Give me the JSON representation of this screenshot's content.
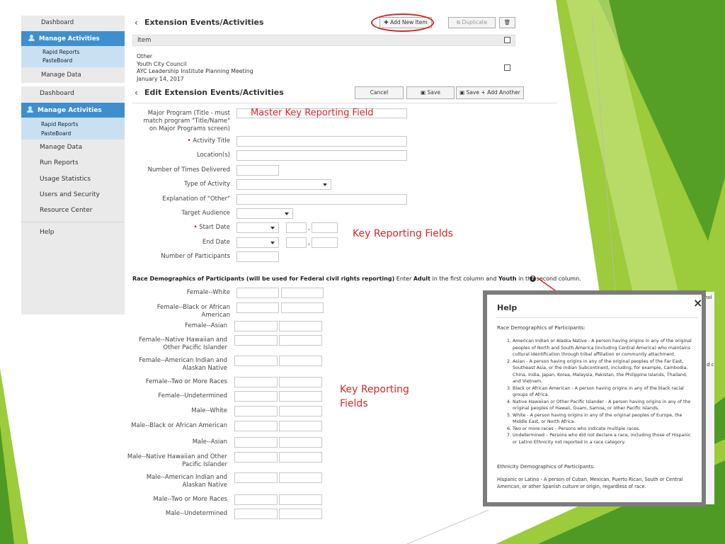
{
  "sidebar_top": {
    "dashboard": "Dashboard",
    "manage_activities": "Manage Activities",
    "rapid_reports": "Rapid Reports",
    "pasteboard": "PasteBoard",
    "manage_data": "Manage Data"
  },
  "sidebar": {
    "dashboard": "Dashboard",
    "manage_activities": "Manage Activities",
    "rapid_reports": "Rapid Reports",
    "pasteboard": "PasteBoard",
    "manage_data": "Manage Data",
    "run_reports": "Run Reports",
    "usage_statistics": "Usage Statistics",
    "users_security": "Users and Security",
    "resource_center": "Resource Center",
    "help": "Help"
  },
  "list": {
    "title": "Extension Events/Activities",
    "add_new": "Add New Item",
    "duplicate": "Duplicate",
    "col_item": "Item",
    "row_lines": [
      "Other",
      "Youth City Council",
      "AYC Leadership Institute Planning Meeting",
      "January 14, 2017"
    ]
  },
  "edit": {
    "title": "Edit Extension Events/Activities",
    "cancel": "Cancel",
    "save": "Save",
    "save_add": "Save + Add Another"
  },
  "form": {
    "major_program": "Major Program (Title - must match program \"Title/Name\" on Major Programs screen)",
    "required_mark": "•",
    "activity_title": "Activity Title",
    "locations": "Location(s)",
    "times_delivered": "Number of Times Delivered",
    "type_activity": "Type of Activity",
    "explanation_other": "Explanation of \"Other\"",
    "target_audience": "Target Audience",
    "start_date": "Start Date",
    "end_date": "End Date",
    "participants": "Number of Participants",
    "date_sep": ","
  },
  "race": {
    "heading_bold": "Race Demographics of Participants (will be used for Federal civil rights reporting)",
    "heading_rest_1": " Enter ",
    "heading_adult": "Adult",
    "heading_rest_2": " in the first column and ",
    "heading_youth": "Youth",
    "heading_rest_3": " in the second column.",
    "help_glyph": "?",
    "rows": [
      "Female--White",
      "Female--Black or African American",
      "Female--Asian",
      "Female--Native Hawaiian and Other Pacific Islander",
      "Female--American Indian and Alaskan Native",
      "Female--Two or More Races",
      "Female--Undetermined",
      "Male--White",
      "Male--Black or African American",
      "Male--Asian",
      "Male--Native Hawaiian and Other Pacific Islander",
      "Male--American Indian and Alaskan Native",
      "Male--Two or More Races",
      "Male--Undetermined"
    ]
  },
  "annotations": {
    "master_key": "Master Key Reporting Field",
    "key_fields_1": "Key Reporting Fields",
    "key_fields_2_line1": "Key Reporting",
    "key_fields_2_line2": "Fields"
  },
  "help_popup": {
    "title": "Help",
    "close": "×",
    "intro": "Race Demographics of Participants:",
    "items": [
      "American Indian or Alaska Native - A person having origins in any of the original peoples of North and South America (including Central America) who maintains cultural identification through tribal affiliation or community attachment.",
      "Asian - A person having origins in any of the original peoples of the Far East, Southeast Asia, or the Indian Subcontinent, including, for example, Cambodia, China, India, Japan, Korea, Malaysia, Pakistan, the Philippine Islands, Thailand, and Vietnam.",
      "Black or African American - A person having origins in any of the black racial groups of Africa.",
      "Native Hawaiian or Other Pacific Islander - A person having origins in any of the original peoples of Hawaii, Guam, Samoa, or other Pacific Islands.",
      "White - A person having origins in any of the original peoples of Europe, the Middle East, or North Africa.",
      "Two or more races – Persons who indicate multiple races.",
      "Undetermined – Persons who did not declare a race, including those of Hispanic or Latino Ethnicity not reported in a race category."
    ],
    "ethnicity_heading": "Ethnicity Demographics of Participants:",
    "ethnicity_text": "Hispanic or Latino - A person of Cuban, Mexican, Puerto Rican, South or Central American, or other Spanish culture or origin, regardless of race.",
    "behind_text_1": "hol",
    "behind_text_2": "d c"
  },
  "colors": {
    "green_dark": "#4f9a25",
    "green_light": "#9ccb3b",
    "accent_blue": "#3f8fce",
    "annotation_red": "#d42828"
  }
}
